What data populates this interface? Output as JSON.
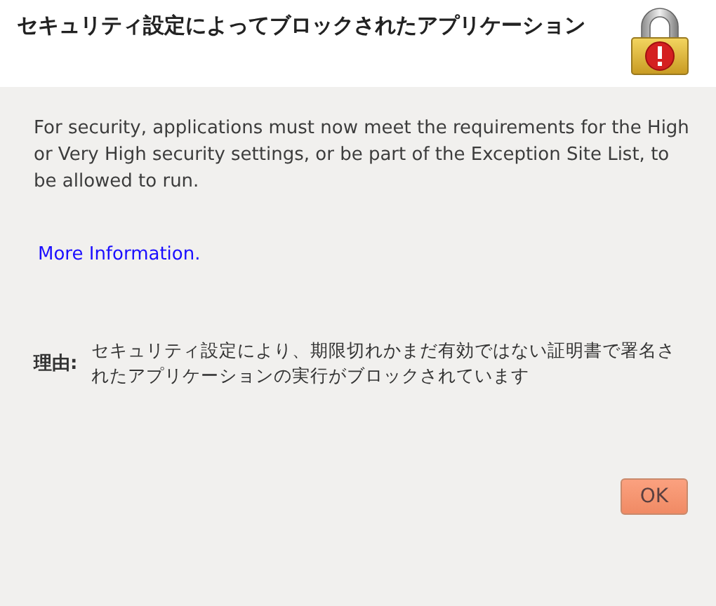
{
  "dialog": {
    "title": "セキュリティ設定によってブロックされたアプリケーション",
    "message": "For security, applications must now meet the requirements for the High or Very High security settings, or be part of the Exception Site List, to be allowed to run.",
    "link": "More Information.",
    "reason": {
      "label": "理由:",
      "text": "セキュリティ設定により、期限切れかまだ有効ではない証明書で署名されたアプリケーションの実行がブロックされています"
    },
    "buttons": [
      "OK"
    ]
  }
}
